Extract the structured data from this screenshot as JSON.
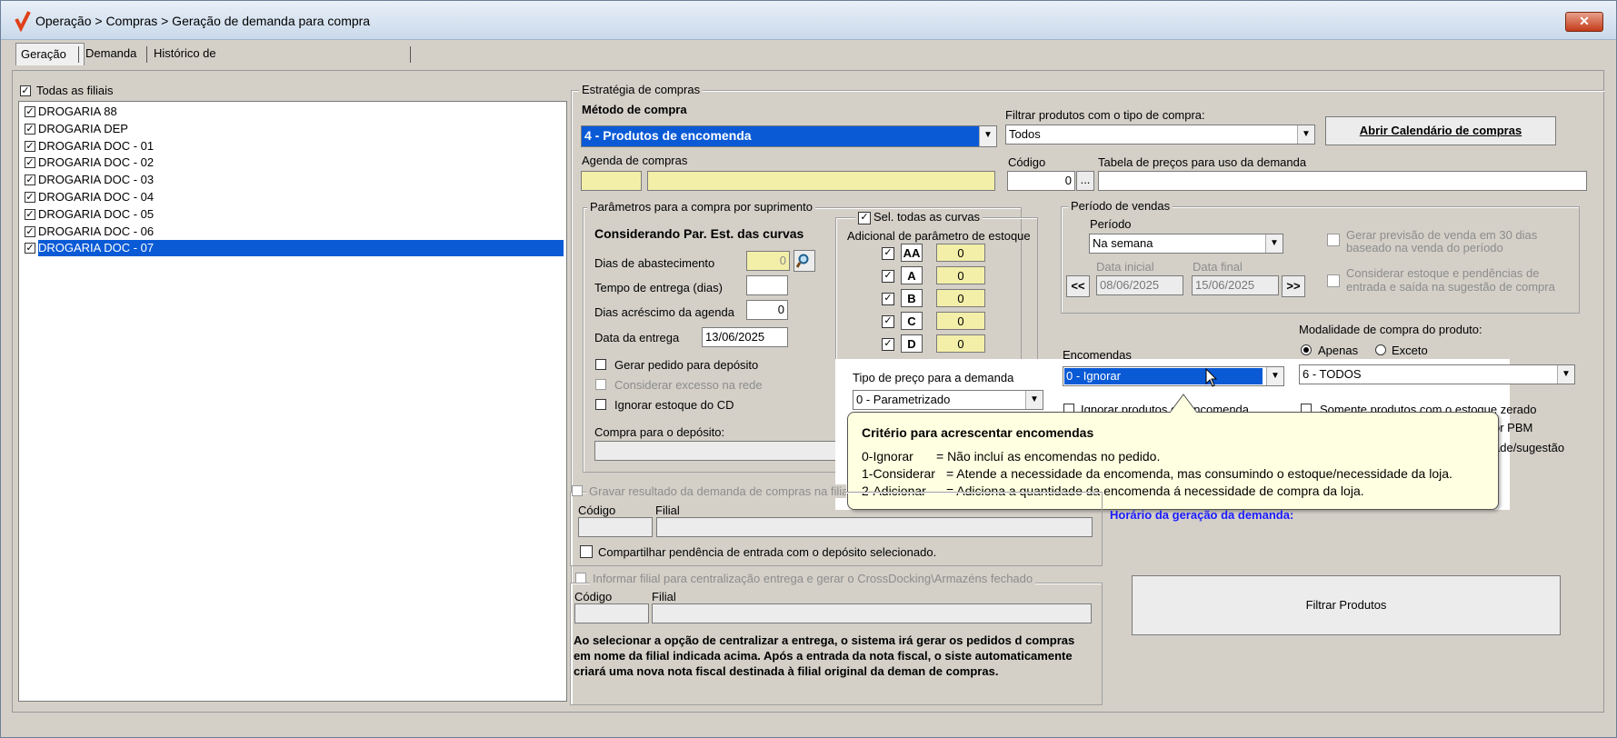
{
  "window": {
    "title": "Operação > Compras > Geração de demanda para compra",
    "close": "✕"
  },
  "tabs": [
    "Geração",
    "Demanda",
    "Histórico de demandas salvas temporariamente"
  ],
  "filiais": {
    "all_label": "Todas as filiais",
    "items": [
      "DROGARIA 88",
      "DROGARIA DEP",
      "DROGARIA DOC - 01",
      "DROGARIA DOC - 02",
      "DROGARIA DOC - 03",
      "DROGARIA DOC - 04",
      "DROGARIA DOC - 05",
      "DROGARIA DOC - 06",
      "DROGARIA DOC - 07"
    ],
    "selected_index": 8
  },
  "estrategia": {
    "group_label": "Estratégia de compras",
    "metodo_label": "Método de compra",
    "metodo_value": "4 - Produtos de encomenda",
    "agenda_label": "Agenda de compras",
    "filtrar_label": "Filtrar produtos com o tipo de compra:",
    "filtrar_value": "Todos",
    "calendario_button": "Abrir Calendário de compras",
    "codigo_label": "Código",
    "codigo_value": "0",
    "ellipsis": "...",
    "tabela_label": "Tabela de preços para uso da demanda"
  },
  "parametros": {
    "group_label": "Parâmetros para a compra por suprimento",
    "considerando": "Considerando Par. Est. das curvas",
    "dias_abast_label": "Dias de abastecimento",
    "dias_abast_value": "0",
    "tempo_entrega_label": "Tempo de entrega (dias)",
    "dias_acrescimo_label": "Dias acréscimo da agenda",
    "dias_acrescimo_value": "0",
    "data_entrega_label": "Data da entrega",
    "data_entrega_value": "13/06/2025",
    "gerar_pedido_label": "Gerar pedido para depósito",
    "considerar_excesso_label": "Considerar excesso na rede",
    "ignorar_estoque_label": "Ignorar estoque do CD",
    "compra_deposito_label": "Compra para o depósito:"
  },
  "curvas": {
    "sel_todas_label": "Sel. todas as curvas",
    "adicional_label": "Adicional de parâmetro de estoque",
    "items": [
      {
        "curve": "AA",
        "value": "0"
      },
      {
        "curve": "A",
        "value": "0"
      },
      {
        "curve": "B",
        "value": "0"
      },
      {
        "curve": "C",
        "value": "0"
      },
      {
        "curve": "D",
        "value": "0"
      }
    ]
  },
  "periodo": {
    "group_label": "Período de vendas",
    "periodo_label": "Período",
    "periodo_value": "Na semana",
    "data_inicial_label": "Data inicial",
    "data_inicial_value": "08/06/2025",
    "data_final_label": "Data final",
    "data_final_value": "15/06/2025",
    "prev_btn": "<<",
    "next_btn": ">>",
    "gerar_previsao_label": "Gerar previsão de venda em 30 dias baseado na venda do período",
    "considerar_estoque_label": "Considerar estoque e pendências de entrada e saída  na sugestão de compra"
  },
  "encomendas": {
    "label": "Encomendas",
    "value": "0 - Ignorar",
    "ignorar_produtos_label": "Ignorar produtos de encomenda"
  },
  "modalidade": {
    "label": "Modalidade de compra do produto:",
    "apenas_label": "Apenas",
    "exceto_label": "Exceto",
    "value": "6 - TODOS",
    "somente_label": "Somente produtos com o estoque zerado",
    "pbm_label": "or PBM",
    "sugestao_label": "ade/sugestão"
  },
  "tipo_preco": {
    "label": "Tipo de preço para a demanda",
    "value": "0 - Parametrizado"
  },
  "tooltip": {
    "title": "Critério para acrescentar encomendas",
    "lines": [
      {
        "code": "0-Ignorar",
        "desc": "= Não incluí as encomendas no pedido."
      },
      {
        "code": "1-Considerar",
        "desc": "= Atende a necessidade da encomenda, mas consumindo o estoque/necessidade da loja."
      },
      {
        "code": "2-Adicionar",
        "desc": "= Adiciona a quantidade da encomenda á necessidade de compra da loja."
      }
    ]
  },
  "gravar": {
    "label": "Gravar resultado da demanda de compras na filial",
    "codigo_label": "Código",
    "filial_label": "Filial",
    "compartilhar_label": "Compartilhar pendência de entrada com o depósito selecionado."
  },
  "centralizar": {
    "label": "Informar filial para centralização entrega e gerar o CrossDocking\\Armazéns fechado",
    "codigo_label": "Código",
    "filial_label": "Filial",
    "info": "Ao selecionar a opção de centralizar a entrega, o sistema irá gerar os pedidos d compras em nome da filial indicada acima. Após a entrada da nota fiscal, o siste automaticamente criará uma nova nota fiscal destinada à filial original da deman de compras."
  },
  "horario_label": "Horário da geração da demanda:",
  "filtrar_button": "Filtrar Produtos",
  "colors": {
    "accent": "#0a4fb8",
    "highlight": "#0a5ad6",
    "yellow": "#f3efa9",
    "tooltip_bg": "#ffffe1",
    "horario": "#1a1aff"
  }
}
